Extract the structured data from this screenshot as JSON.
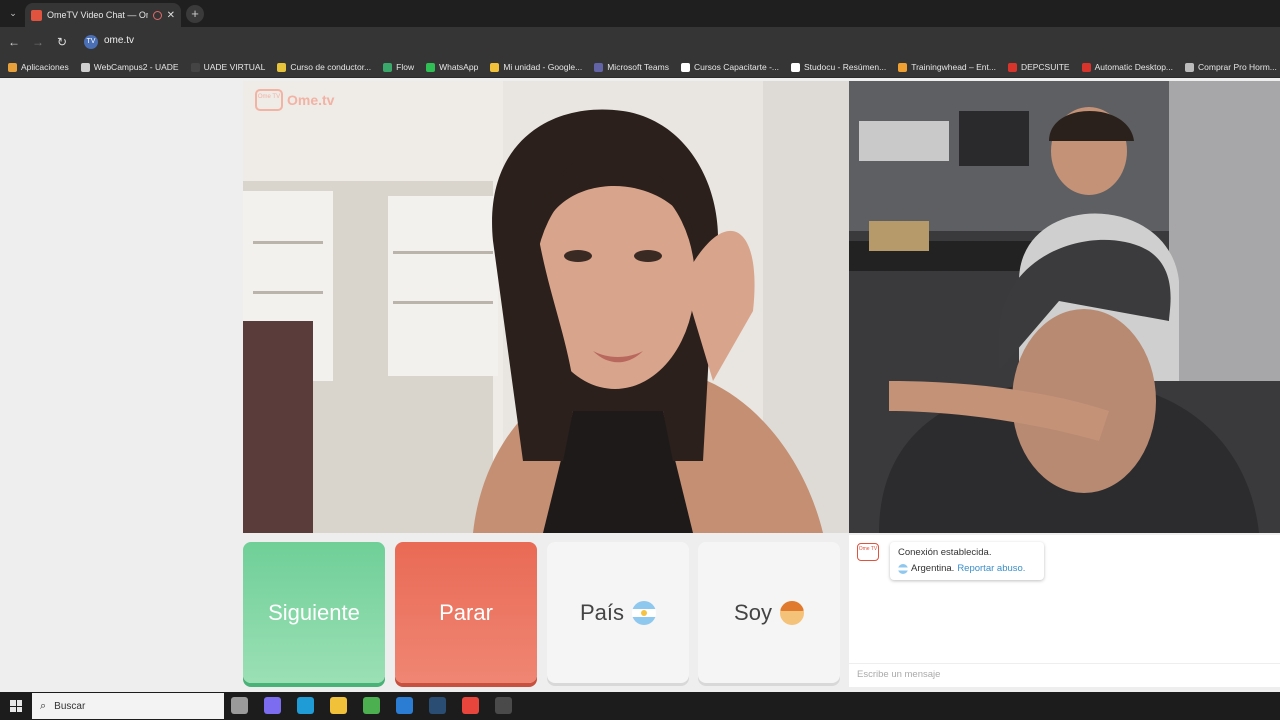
{
  "browser": {
    "tab_title": "OmeTV Video Chat — Ome",
    "url": "ome.tv",
    "site_icon_text": "TV",
    "bookmarks": [
      {
        "label": "Aplicaciones",
        "color": "#e8a13a"
      },
      {
        "label": "WebCampus2 - UADE",
        "color": "#cfcfcf"
      },
      {
        "label": "UADE VIRTUAL",
        "color": "#444444"
      },
      {
        "label": "Curso de conductor...",
        "color": "#e6c33a"
      },
      {
        "label": "Flow",
        "color": "#3aa86b"
      },
      {
        "label": "WhatsApp",
        "color": "#2fbf55"
      },
      {
        "label": "Mi unidad - Google...",
        "color": "#f2c13a"
      },
      {
        "label": "Microsoft Teams",
        "color": "#6264a7"
      },
      {
        "label": "Cursos Capacitarte -...",
        "color": "#ffffff"
      },
      {
        "label": "Studocu - Resúmen...",
        "color": "#ffffff"
      },
      {
        "label": "Trainingwhead – Ent...",
        "color": "#f0a030"
      },
      {
        "label": "DEPCSUITE",
        "color": "#d9342b"
      },
      {
        "label": "Automatic Desktop...",
        "color": "#d9342b"
      },
      {
        "label": "Comprar Pro Horm...",
        "color": "#bbbbbb"
      }
    ]
  },
  "app": {
    "logo_text": "Ome.tv",
    "logo_badge": "Ome TV",
    "buttons": {
      "next": "Siguiente",
      "stop": "Parar",
      "country": "País",
      "gender": "Soy"
    },
    "chat": {
      "avatar_text": "Ome TV",
      "status": "Conexión establecida.",
      "country": "Argentina.",
      "report": "Reportar abuso.",
      "input_placeholder": "Escribe un mensaje"
    }
  },
  "taskbar": {
    "search_placeholder": "Buscar",
    "icons": [
      {
        "name": "task-view-icon",
        "color": "#9a9a9a"
      },
      {
        "name": "copilot-icon",
        "color": "#7b6cf0"
      },
      {
        "name": "edge-icon",
        "color": "#1f9bd6"
      },
      {
        "name": "file-explorer-icon",
        "color": "#f2c13a"
      },
      {
        "name": "store-icon",
        "color": "#4caf50"
      },
      {
        "name": "outlook-icon",
        "color": "#2b7cd3"
      },
      {
        "name": "steam-icon",
        "color": "#2a4d73"
      },
      {
        "name": "chrome-icon",
        "color": "#e8453c"
      },
      {
        "name": "obs-icon",
        "color": "#4a4a4a"
      }
    ]
  }
}
